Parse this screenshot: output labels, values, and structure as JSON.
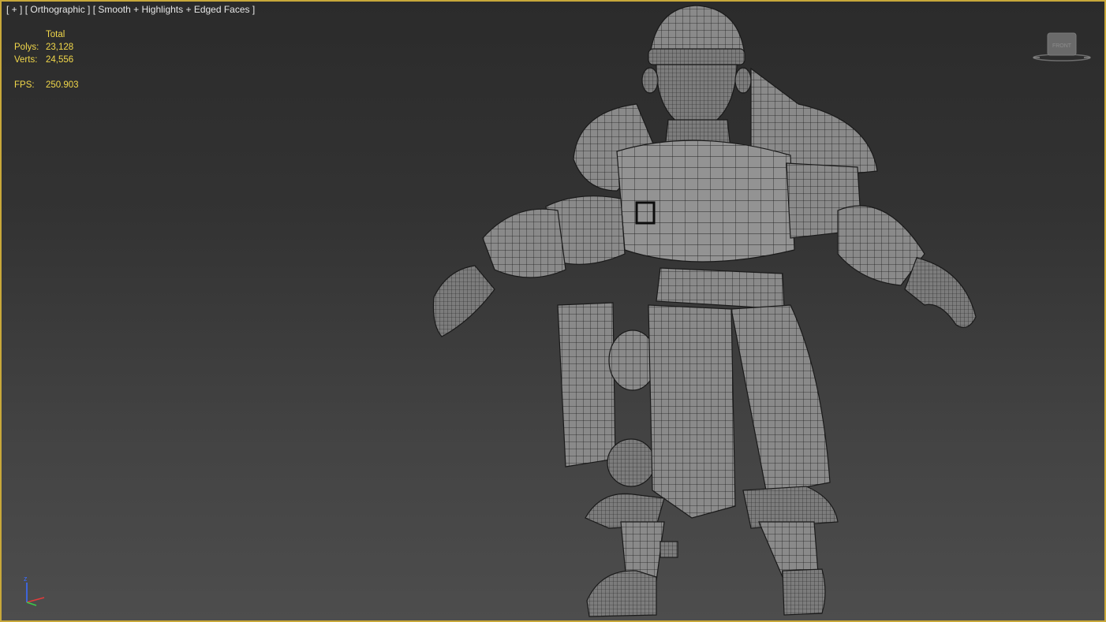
{
  "viewport": {
    "label_plus": "[ + ]",
    "label_view": "[ Orthographic ]",
    "label_shading": "[ Smooth + Highlights + Edged Faces ]",
    "border_color": "#c8a83a"
  },
  "stats": {
    "header": "Total",
    "polys_label": "Polys:",
    "polys_value": "23,128",
    "verts_label": "Verts:",
    "verts_value": "24,556",
    "fps_label": "FPS:",
    "fps_value": "250.903",
    "color": "#f2d84a"
  },
  "viewcube": {
    "face_label": "FRONT",
    "icon": "viewcube-icon"
  },
  "axis_gizmo": {
    "z_label": "z",
    "icon": "axis-tripod-icon"
  },
  "model": {
    "icon": "wireframe-character-model"
  }
}
